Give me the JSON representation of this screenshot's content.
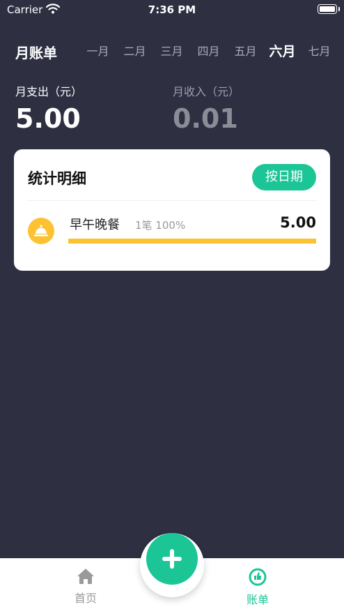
{
  "status": {
    "carrier": "Carrier",
    "time": "7:36 PM"
  },
  "header": {
    "title": "月账单",
    "months": [
      "一月",
      "二月",
      "三月",
      "四月",
      "五月",
      "六月",
      "七月"
    ],
    "active_month": "六月"
  },
  "summary": {
    "expense_label": "月支出（元）",
    "expense_value": "5.00",
    "income_label": "月收入（元）",
    "income_value": "0.01"
  },
  "card": {
    "title": "统计明细",
    "by_date_label": "按日期",
    "items": [
      {
        "name": "早午晚餐",
        "meta": "1笔 100%",
        "amount": "5.00",
        "percent": 100,
        "icon": "service-bell-icon",
        "color": "#fcc231"
      }
    ]
  },
  "tabs": {
    "home_label": "首页",
    "bill_label": "账单"
  },
  "colors": {
    "accent": "#1cc596",
    "background": "#2e3042",
    "category": "#fcc231"
  }
}
